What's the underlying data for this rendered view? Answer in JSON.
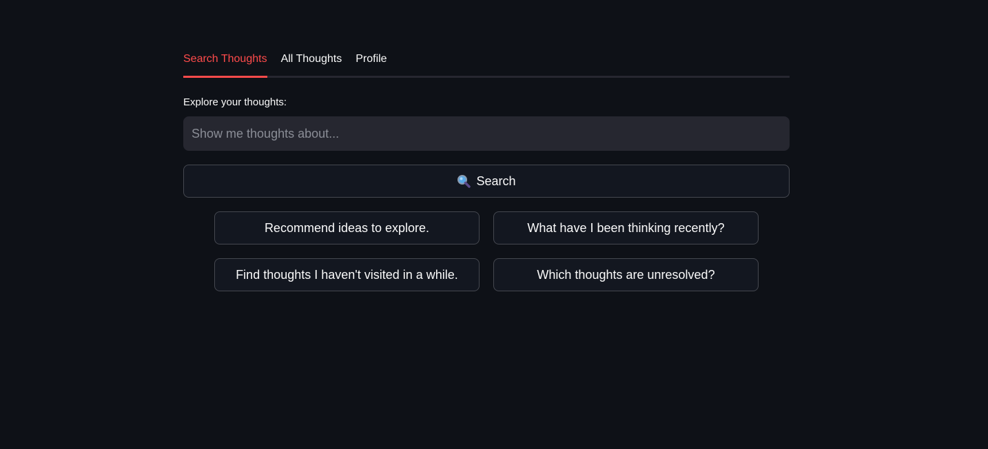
{
  "tabs": [
    {
      "label": "Search Thoughts",
      "active": true
    },
    {
      "label": "All Thoughts",
      "active": false
    },
    {
      "label": "Profile",
      "active": false
    }
  ],
  "search": {
    "label": "Explore your thoughts:",
    "placeholder": "Show me thoughts about...",
    "value": "",
    "button_label": "Search",
    "button_icon": "magnifying-glass-icon"
  },
  "suggestions": [
    "Recommend ideas to explore.",
    "What have I been thinking recently?",
    "Find thoughts I haven't visited in a while.",
    "Which thoughts are unresolved?"
  ],
  "colors": {
    "background": "#0e1117",
    "accent": "#ff4b4b",
    "input_background": "#262730",
    "text": "#fafafa"
  }
}
